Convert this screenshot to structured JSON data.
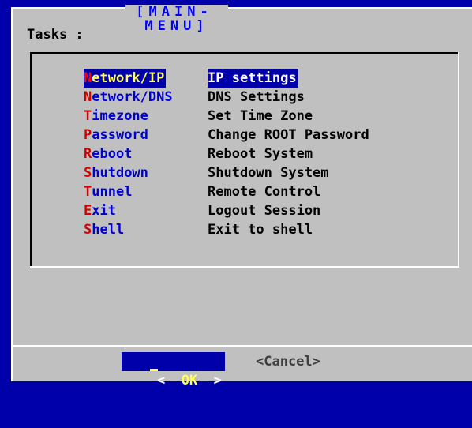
{
  "title": "[MAIN-MENU]",
  "prompt": "Tasks :",
  "menu": [
    {
      "tag_first": "N",
      "tag_rest": "etwork/IP",
      "desc": "IP settings",
      "selected": true
    },
    {
      "tag_first": "N",
      "tag_rest": "etwork/DNS",
      "desc": "DNS Settings",
      "selected": false
    },
    {
      "tag_first": "T",
      "tag_rest": "imezone",
      "desc": "Set Time Zone",
      "selected": false
    },
    {
      "tag_first": "P",
      "tag_rest": "assword",
      "desc": "Change ROOT Password",
      "selected": false
    },
    {
      "tag_first": "R",
      "tag_rest": "eboot",
      "desc": "Reboot System",
      "selected": false
    },
    {
      "tag_first": "S",
      "tag_rest": "hutdown",
      "desc": "Shutdown System",
      "selected": false
    },
    {
      "tag_first": "T",
      "tag_rest": "unnel",
      "desc": "Remote Control",
      "selected": false
    },
    {
      "tag_first": "E",
      "tag_rest": "xit",
      "desc": "Logout Session",
      "selected": false
    },
    {
      "tag_first": "S",
      "tag_rest": "hell",
      "desc": "Exit to shell",
      "selected": false
    }
  ],
  "buttons": {
    "ok_left": "<",
    "ok_label": "OK",
    "ok_right": ">",
    "cancel_label": "<Cancel>"
  },
  "colors": {
    "background": "#0000aa",
    "dialog": "#c0c0c0",
    "title": "#0000ff",
    "hotkey": "#d40000",
    "tag": "#0000d0",
    "highlight_fg": "#ffff55"
  }
}
